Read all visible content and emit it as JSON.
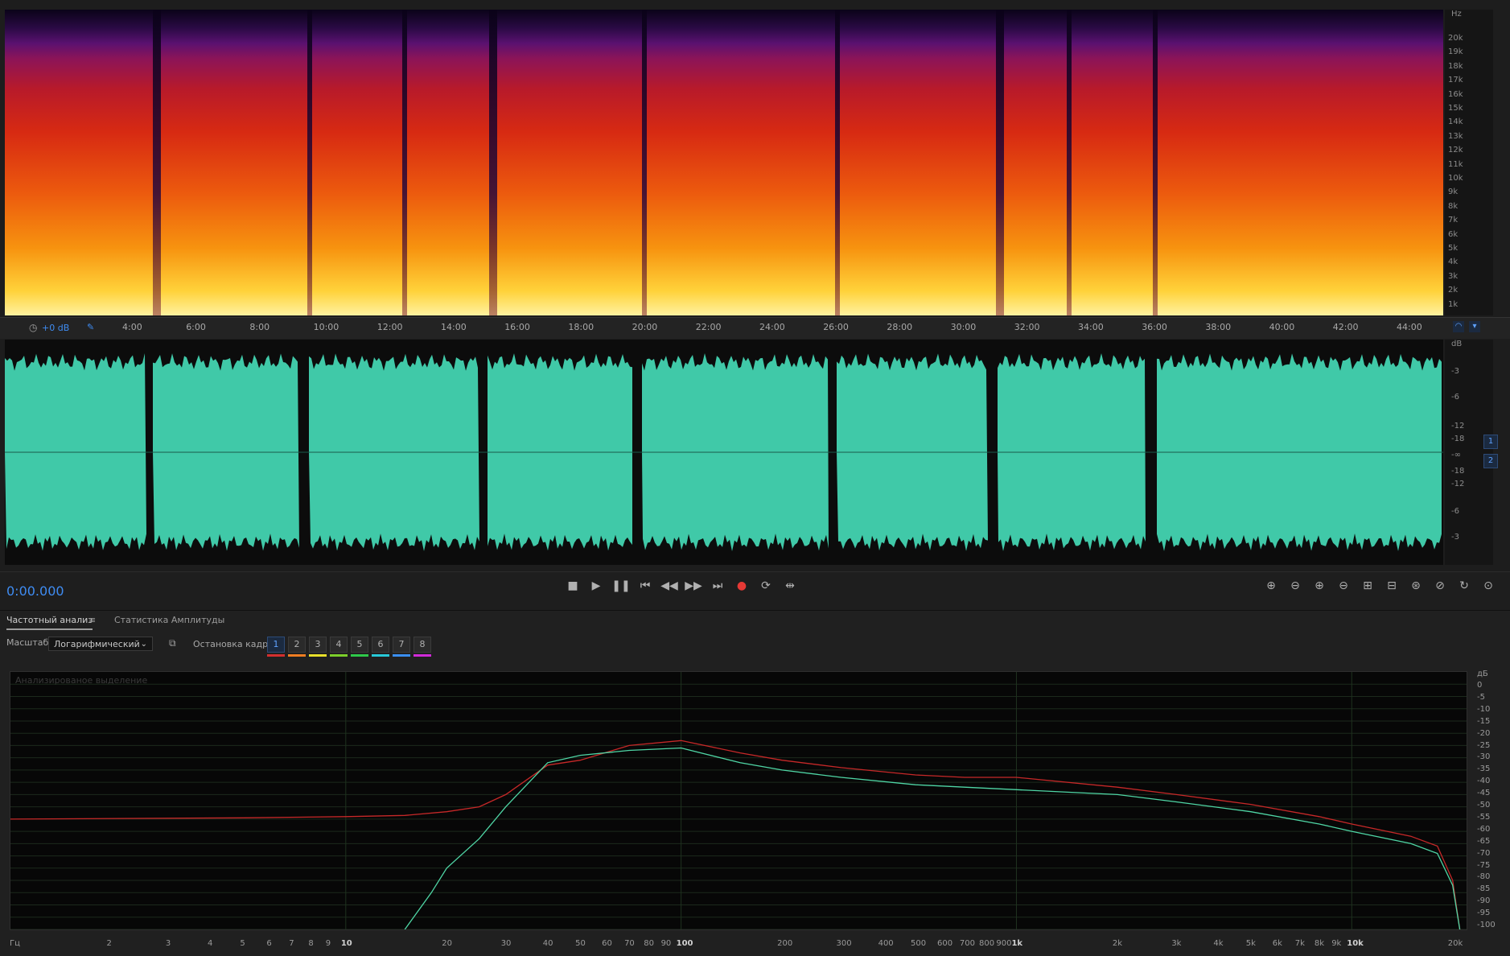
{
  "spectrogram": {
    "unit": "Hz",
    "freq_labels": [
      "20k",
      "19k",
      "18k",
      "17k",
      "16k",
      "15k",
      "14k",
      "13k",
      "12k",
      "11k",
      "10k",
      "9k",
      "8k",
      "7k",
      "6k",
      "5k",
      "4k",
      "3k",
      "2k",
      "1k"
    ],
    "colors": {
      "low": "#2a0a44",
      "mid": "#d72a12",
      "high": "#ffd23a"
    }
  },
  "timeline": {
    "gain_label": "+0 dB",
    "ticks": [
      "4:00",
      "6:00",
      "8:00",
      "10:00",
      "12:00",
      "14:00",
      "16:00",
      "18:00",
      "20:00",
      "22:00",
      "24:00",
      "26:00",
      "28:00",
      "30:00",
      "32:00",
      "34:00",
      "36:00",
      "38:00",
      "40:00",
      "42:00",
      "44:00"
    ]
  },
  "waveform": {
    "unit": "dB",
    "db_labels_top": [
      "-3",
      "-6",
      "-12",
      "-18"
    ],
    "inf_label": "-∞",
    "db_labels_bottom": [
      "-18",
      "-12",
      "-6",
      "-3"
    ],
    "channels": [
      "1",
      "2"
    ],
    "color": "#40c9a8"
  },
  "transport": {
    "time": "0:00.000",
    "stop_icon": "stop-icon",
    "play_icon": "play-icon",
    "pause_icon": "pause-icon",
    "record_color": "#e53935"
  },
  "analysis_panel": {
    "tabs": [
      "Частотный анализ",
      "Статистика Амплитуды"
    ],
    "scale_label": "Масштаб:",
    "scale_value": "Логарифмический",
    "freeze_label": "Остановка кадра:",
    "frames": [
      "1",
      "2",
      "3",
      "4",
      "5",
      "6",
      "7",
      "8"
    ],
    "frame_colors": [
      "#d32f2f",
      "#ef7d22",
      "#e8e02a",
      "#7ccf2a",
      "#2ec94a",
      "#27c9d8",
      "#3a8ef0",
      "#d12ad8"
    ],
    "plot_caption": "Анализированое выделение"
  },
  "chart_data": {
    "type": "line",
    "xlabel": "Гц",
    "ylabel": "дБ",
    "x_scale": "log",
    "xlim": [
      1,
      22000
    ],
    "ylim": [
      -100,
      5
    ],
    "x_tick_labels": [
      "2",
      "3",
      "4",
      "5",
      "6",
      "7",
      "8",
      "9",
      "10",
      "20",
      "30",
      "40",
      "50",
      "60",
      "70",
      "80",
      "90",
      "100",
      "200",
      "300",
      "400",
      "500",
      "600",
      "700",
      "800",
      "900",
      "1k",
      "2k",
      "3k",
      "4k",
      "5k",
      "6k",
      "7k",
      "8k",
      "9k",
      "10k",
      "20k"
    ],
    "x_tick_values": [
      2,
      3,
      4,
      5,
      6,
      7,
      8,
      9,
      10,
      20,
      30,
      40,
      50,
      60,
      70,
      80,
      90,
      100,
      200,
      300,
      400,
      500,
      600,
      700,
      800,
      900,
      1000,
      2000,
      3000,
      4000,
      5000,
      6000,
      7000,
      8000,
      9000,
      10000,
      20000
    ],
    "y_tick_labels": [
      "0",
      "-5",
      "-10",
      "-15",
      "-20",
      "-25",
      "-30",
      "-35",
      "-40",
      "-45",
      "-50",
      "-55",
      "-60",
      "-65",
      "-70",
      "-75",
      "-80",
      "-85",
      "-90",
      "-95",
      "-100"
    ],
    "series": [
      {
        "color": "#c62828",
        "x": [
          1,
          5,
          10,
          15,
          20,
          25,
          30,
          40,
          50,
          70,
          100,
          150,
          200,
          300,
          500,
          700,
          1000,
          2000,
          3000,
          5000,
          8000,
          10000,
          15000,
          18000,
          20000,
          21000
        ],
        "y": [
          -55,
          -54.5,
          -54,
          -53.5,
          -52,
          -50,
          -45,
          -33,
          -31,
          -25,
          -23,
          -28,
          -31,
          -34,
          -37,
          -38,
          -38,
          -42,
          -45,
          -49,
          -54,
          -57,
          -62,
          -66,
          -80,
          -100
        ]
      },
      {
        "color": "#4fd6a5",
        "x": [
          15,
          18,
          20,
          25,
          30,
          40,
          50,
          70,
          100,
          150,
          200,
          300,
          500,
          700,
          1000,
          2000,
          3000,
          5000,
          8000,
          10000,
          15000,
          18000,
          20000,
          21000
        ],
        "y": [
          -100,
          -85,
          -75,
          -63,
          -50,
          -32,
          -29,
          -27,
          -26,
          -32,
          -35,
          -38,
          -41,
          -42,
          -43,
          -45,
          -48,
          -52,
          -57,
          -60,
          -65,
          -69,
          -82,
          -100
        ]
      }
    ]
  }
}
